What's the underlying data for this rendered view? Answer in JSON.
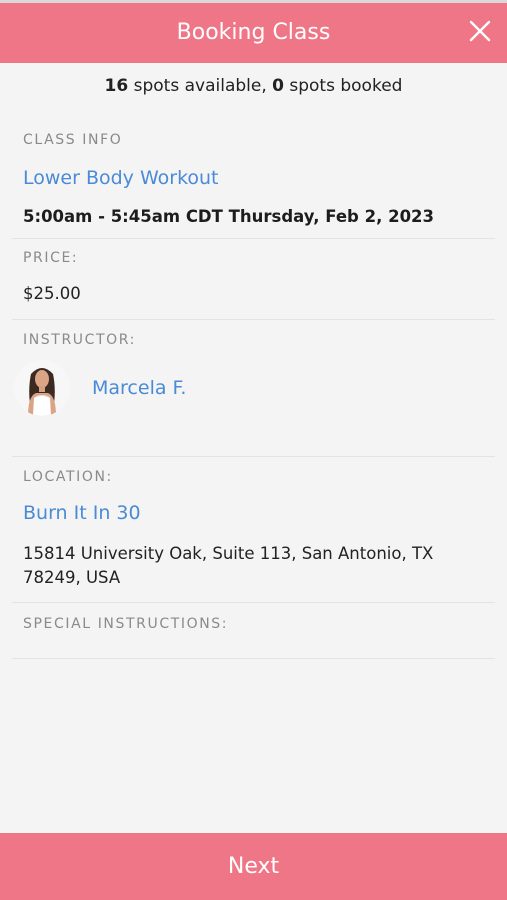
{
  "header": {
    "title": "Booking Class"
  },
  "spots": {
    "available_count": "16",
    "available_text": " spots available, ",
    "booked_count": "0",
    "booked_text": " spots booked"
  },
  "class_info": {
    "label": "CLASS INFO",
    "name": "Lower Body Workout",
    "time": "5:00am - 5:45am CDT Thursday, Feb 2, 2023"
  },
  "price": {
    "label": "PRICE:",
    "value": "$25.00"
  },
  "instructor": {
    "label": "INSTRUCTOR:",
    "name": "Marcela F."
  },
  "location": {
    "label": "LOCATION:",
    "name": "Burn It In 30",
    "address": "15814 University Oak, Suite 113, San Antonio, TX 78249, USA"
  },
  "special_instructions": {
    "label": "SPECIAL INSTRUCTIONS:"
  },
  "footer": {
    "next_label": "Next"
  },
  "colors": {
    "header_bg": "#ef7686",
    "link": "#4a8ad6",
    "page_bg": "#f4f4f4"
  },
  "icons": {
    "close": "close-icon"
  }
}
